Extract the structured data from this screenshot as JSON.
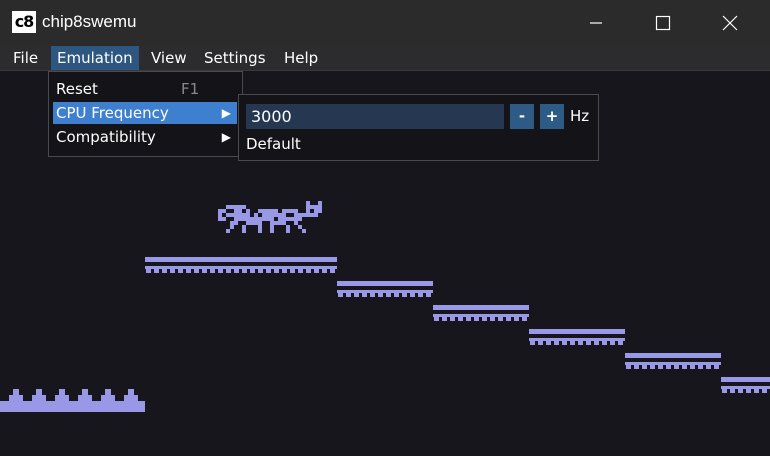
{
  "window": {
    "app_icon_text": "c8",
    "title": "chip8swemu",
    "minimize": "minimize",
    "maximize": "maximize",
    "close": "close"
  },
  "menubar": {
    "items": [
      "File",
      "Emulation",
      "View",
      "Settings",
      "Help"
    ],
    "active": "Emulation"
  },
  "emulation_menu": {
    "reset_label": "Reset",
    "reset_shortcut": "F1",
    "cpu_frequency_label": "CPU Frequency",
    "compatibility_label": "Compatibility",
    "submenu_arrow": "▶"
  },
  "cpu_frequency_submenu": {
    "value": "3000",
    "decrement_label": "-",
    "increment_label": "+",
    "unit": "Hz",
    "default_label": "Default"
  },
  "colors": {
    "background": "#17161d",
    "sprite": "#9898e6",
    "menu_highlight": "#3f7fcf",
    "menu_active": "#2d5680"
  }
}
